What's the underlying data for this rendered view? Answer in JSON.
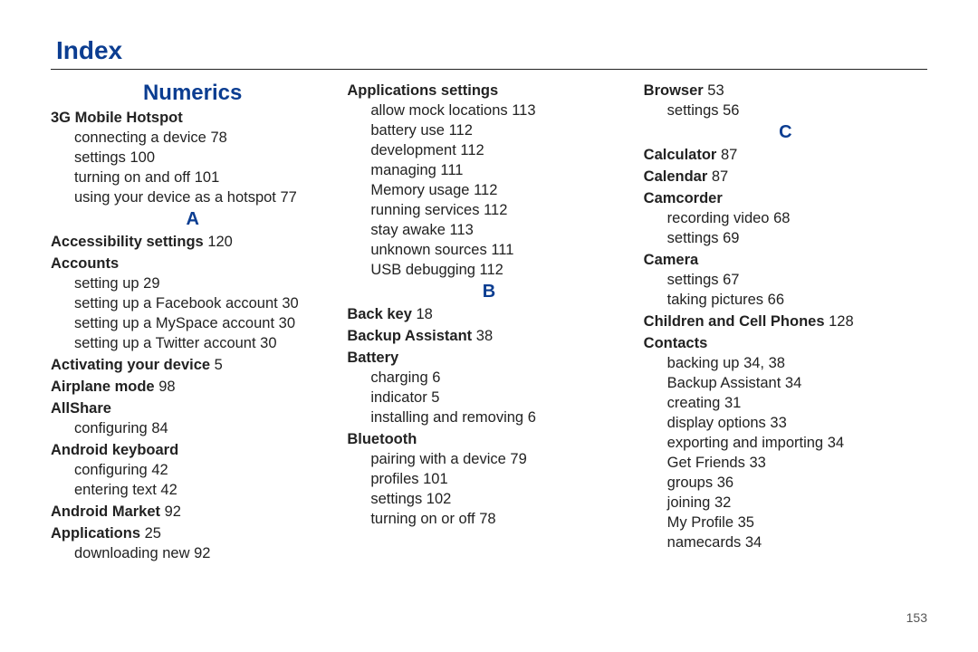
{
  "page_title": "Index",
  "page_number": "153",
  "cols": [
    [
      {
        "t": "section",
        "label": "Numerics"
      },
      {
        "t": "topic",
        "label": "3G Mobile Hotspot"
      },
      {
        "t": "sub",
        "label": "connecting a device",
        "p": "78"
      },
      {
        "t": "sub",
        "label": "settings",
        "p": "100"
      },
      {
        "t": "sub",
        "label": "turning on and off",
        "p": "101"
      },
      {
        "t": "sub",
        "label": "using your device as a hotspot",
        "p": "77"
      },
      {
        "t": "letter",
        "label": "A"
      },
      {
        "t": "topic",
        "label": "Accessibility settings",
        "p": "120"
      },
      {
        "t": "topic",
        "label": "Accounts"
      },
      {
        "t": "sub",
        "label": "setting up",
        "p": "29"
      },
      {
        "t": "sub",
        "label": "setting up a Facebook account",
        "p": "30"
      },
      {
        "t": "sub",
        "label": "setting up a MySpace account",
        "p": "30"
      },
      {
        "t": "sub",
        "label": "setting up a Twitter account",
        "p": "30"
      },
      {
        "t": "topic",
        "label": "Activating your device",
        "p": "5"
      },
      {
        "t": "topic",
        "label": "Airplane mode",
        "p": "98"
      },
      {
        "t": "topic",
        "label": "AllShare"
      },
      {
        "t": "sub",
        "label": "configuring",
        "p": "84"
      },
      {
        "t": "topic",
        "label": "Android keyboard"
      },
      {
        "t": "sub",
        "label": "configuring",
        "p": "42"
      },
      {
        "t": "sub",
        "label": "entering text",
        "p": "42"
      },
      {
        "t": "topic",
        "label": "Android Market",
        "p": "92"
      },
      {
        "t": "topic",
        "label": "Applications",
        "p": "25"
      },
      {
        "t": "sub",
        "label": "downloading new",
        "p": "92"
      }
    ],
    [
      {
        "t": "topic",
        "label": "Applications settings"
      },
      {
        "t": "sub",
        "label": "allow mock locations",
        "p": "113"
      },
      {
        "t": "sub",
        "label": "battery use",
        "p": "112"
      },
      {
        "t": "sub",
        "label": "development",
        "p": "112"
      },
      {
        "t": "sub",
        "label": "managing",
        "p": "111"
      },
      {
        "t": "sub",
        "label": "Memory usage",
        "p": "112"
      },
      {
        "t": "sub",
        "label": "running services",
        "p": "112"
      },
      {
        "t": "sub",
        "label": "stay awake",
        "p": "113"
      },
      {
        "t": "sub",
        "label": "unknown sources",
        "p": "111"
      },
      {
        "t": "sub",
        "label": "USB debugging",
        "p": "112"
      },
      {
        "t": "letter",
        "label": "B"
      },
      {
        "t": "topic",
        "label": "Back key",
        "p": "18"
      },
      {
        "t": "topic",
        "label": "Backup Assistant",
        "p": "38"
      },
      {
        "t": "topic",
        "label": "Battery"
      },
      {
        "t": "sub",
        "label": "charging",
        "p": "6"
      },
      {
        "t": "sub",
        "label": "indicator",
        "p": "5"
      },
      {
        "t": "sub",
        "label": "installing and removing",
        "p": "6"
      },
      {
        "t": "topic",
        "label": "Bluetooth"
      },
      {
        "t": "sub",
        "label": "pairing with a device",
        "p": "79"
      },
      {
        "t": "sub",
        "label": "profiles",
        "p": "101"
      },
      {
        "t": "sub",
        "label": "settings",
        "p": "102"
      },
      {
        "t": "sub",
        "label": "turning on or off",
        "p": "78"
      }
    ],
    [
      {
        "t": "topic",
        "label": "Browser",
        "p": "53"
      },
      {
        "t": "sub",
        "label": "settings",
        "p": "56"
      },
      {
        "t": "letter",
        "label": "C"
      },
      {
        "t": "topic",
        "label": "Calculator",
        "p": "87"
      },
      {
        "t": "topic",
        "label": "Calendar",
        "p": "87"
      },
      {
        "t": "topic",
        "label": "Camcorder"
      },
      {
        "t": "sub",
        "label": "recording video",
        "p": "68"
      },
      {
        "t": "sub",
        "label": "settings",
        "p": "69"
      },
      {
        "t": "topic",
        "label": "Camera"
      },
      {
        "t": "sub",
        "label": "settings",
        "p": "67"
      },
      {
        "t": "sub",
        "label": "taking pictures",
        "p": "66"
      },
      {
        "t": "topic",
        "label": "Children and Cell Phones",
        "p": "128"
      },
      {
        "t": "topic",
        "label": "Contacts"
      },
      {
        "t": "sub",
        "label": "backing up",
        "p": "34, 38"
      },
      {
        "t": "sub",
        "label": "Backup Assistant",
        "p": "34"
      },
      {
        "t": "sub",
        "label": "creating",
        "p": "31"
      },
      {
        "t": "sub",
        "label": "display options",
        "p": "33"
      },
      {
        "t": "sub",
        "label": "exporting and importing",
        "p": "34"
      },
      {
        "t": "sub",
        "label": "Get Friends",
        "p": "33"
      },
      {
        "t": "sub",
        "label": "groups",
        "p": "36"
      },
      {
        "t": "sub",
        "label": "joining",
        "p": "32"
      },
      {
        "t": "sub",
        "label": "My Profile",
        "p": "35"
      },
      {
        "t": "sub",
        "label": "namecards",
        "p": "34"
      }
    ]
  ]
}
